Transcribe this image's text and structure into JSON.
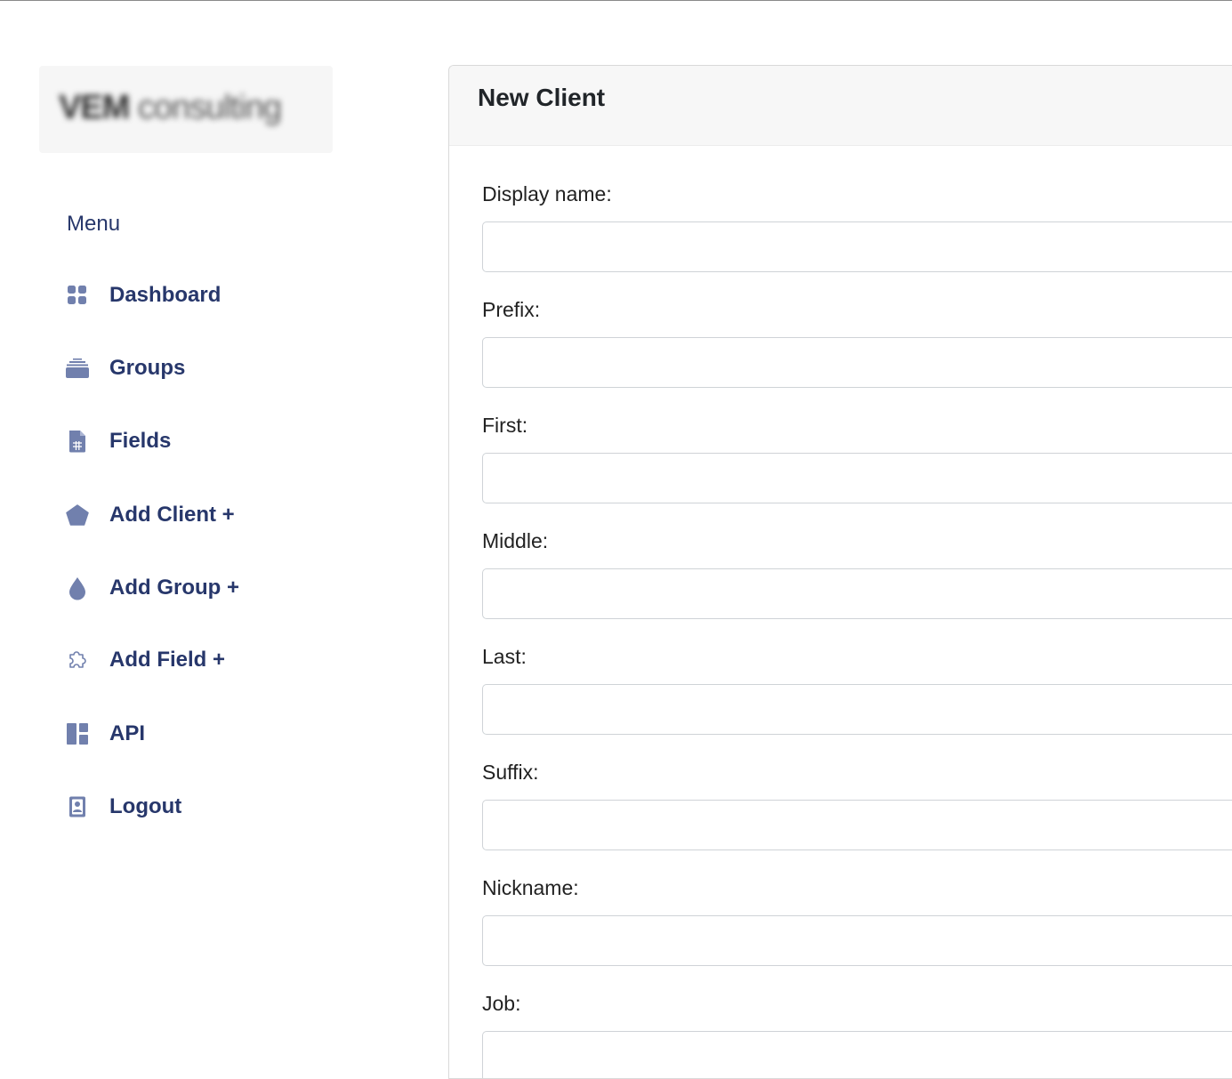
{
  "brand": {
    "logo_text_bold": "VEM",
    "logo_text_light": "consulting"
  },
  "sidebar": {
    "menu_title": "Menu",
    "items": [
      {
        "label": "Dashboard",
        "icon": "dashboard-grid-icon"
      },
      {
        "label": "Groups",
        "icon": "layers-tray-icon"
      },
      {
        "label": "Fields",
        "icon": "document-table-icon"
      },
      {
        "label": "Add Client +",
        "icon": "pentagon-icon"
      },
      {
        "label": "Add Group +",
        "icon": "droplet-icon"
      },
      {
        "label": "Add Field +",
        "icon": "puzzle-icon"
      },
      {
        "label": "API",
        "icon": "layout-panels-icon"
      },
      {
        "label": "Logout",
        "icon": "contact-badge-icon"
      }
    ]
  },
  "form": {
    "title": "New Client",
    "fields": [
      {
        "label": "Display name:",
        "value": ""
      },
      {
        "label": "Prefix:",
        "value": ""
      },
      {
        "label": "First:",
        "value": ""
      },
      {
        "label": "Middle:",
        "value": ""
      },
      {
        "label": "Last:",
        "value": ""
      },
      {
        "label": "Suffix:",
        "value": ""
      },
      {
        "label": "Nickname:",
        "value": ""
      },
      {
        "label": "Job:",
        "value": ""
      }
    ]
  },
  "colors": {
    "nav_text": "#27376b",
    "icon": "#7180ad",
    "header_bg": "#f7f7f7",
    "border": "#cfd3d7"
  }
}
